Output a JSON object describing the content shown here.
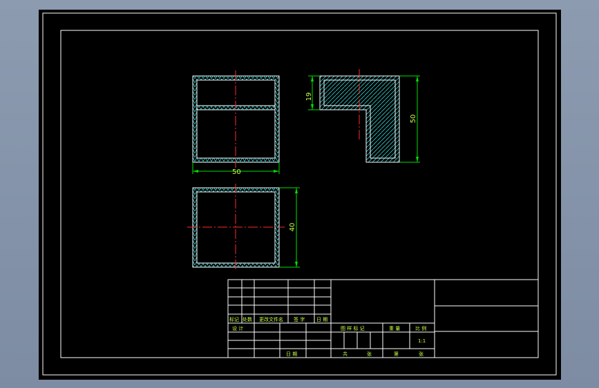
{
  "drawing": {
    "dimensions": {
      "front_width": "50",
      "side_top_thickness": "19",
      "side_height": "50",
      "top_depth": "40"
    },
    "title_block": {
      "rev_headers": [
        "标记",
        "处数",
        "更改文件名",
        "签 字",
        "日 期"
      ],
      "design_label": "设 计",
      "date_label": "日 期",
      "stage_mark_label": "图 样 标 记",
      "weight_label": "重 量",
      "scale_label": "比 例",
      "scale_value": "1:1",
      "total_label": "共",
      "sheet_label": "张",
      "sheet_no_label": "第",
      "sheet_label_2": "张"
    },
    "colors": {
      "frame": "#ffffff",
      "outline": "#ffffff",
      "hatch": "#35d5d5",
      "center_line": "#ff2a2a",
      "dimension": "#00e000",
      "text": "#c8ff46"
    }
  }
}
